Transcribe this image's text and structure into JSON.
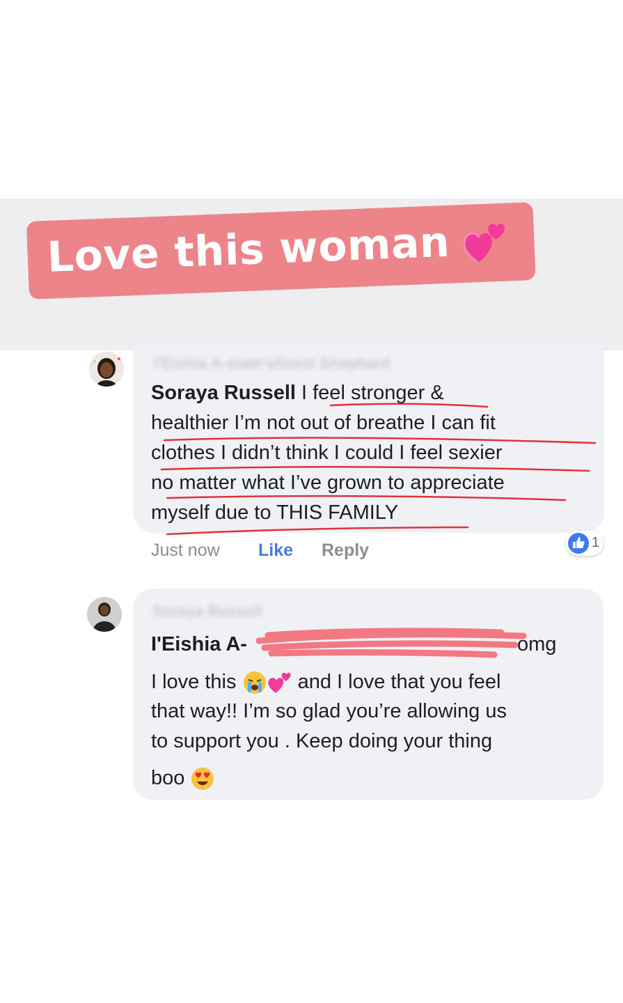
{
  "sticker": {
    "text": "Love this woman",
    "hearts_icon": "two-hearts-icon"
  },
  "comment1": {
    "blurred_header": "l'Eishia A-state'sfinest Shephard",
    "author": "Soraya Russell",
    "lines": [
      " I feel stronger &",
      "healthier I’m not out of breathe I can fit",
      "clothes I didn’t think I could  I feel sexier",
      "no matter what I’ve grown to appreciate",
      "myself due to THIS FAMILY"
    ],
    "time": "Just now",
    "like_label": "Like",
    "reply_label": "Reply",
    "reaction_count": "1",
    "reaction_icon": "thumbs-up-icon"
  },
  "comment2": {
    "blurred_header": "Soraya Russell",
    "author": "I'Eishia A-",
    "line1_tail": "omg",
    "line2_a": "I love this ",
    "line2_b": " and I love that you feel",
    "line3": "that way!! I’m so glad you’re allowing us",
    "line4": "to support you . Keep doing your thing",
    "line5": "boo "
  },
  "colors": {
    "sticker_bg": "#ec8489",
    "band_bg": "#eeeef1",
    "bubble_bg": "#f0f1f5",
    "like_blue": "#4b7bd6",
    "scribble_red": "#e0323c"
  }
}
